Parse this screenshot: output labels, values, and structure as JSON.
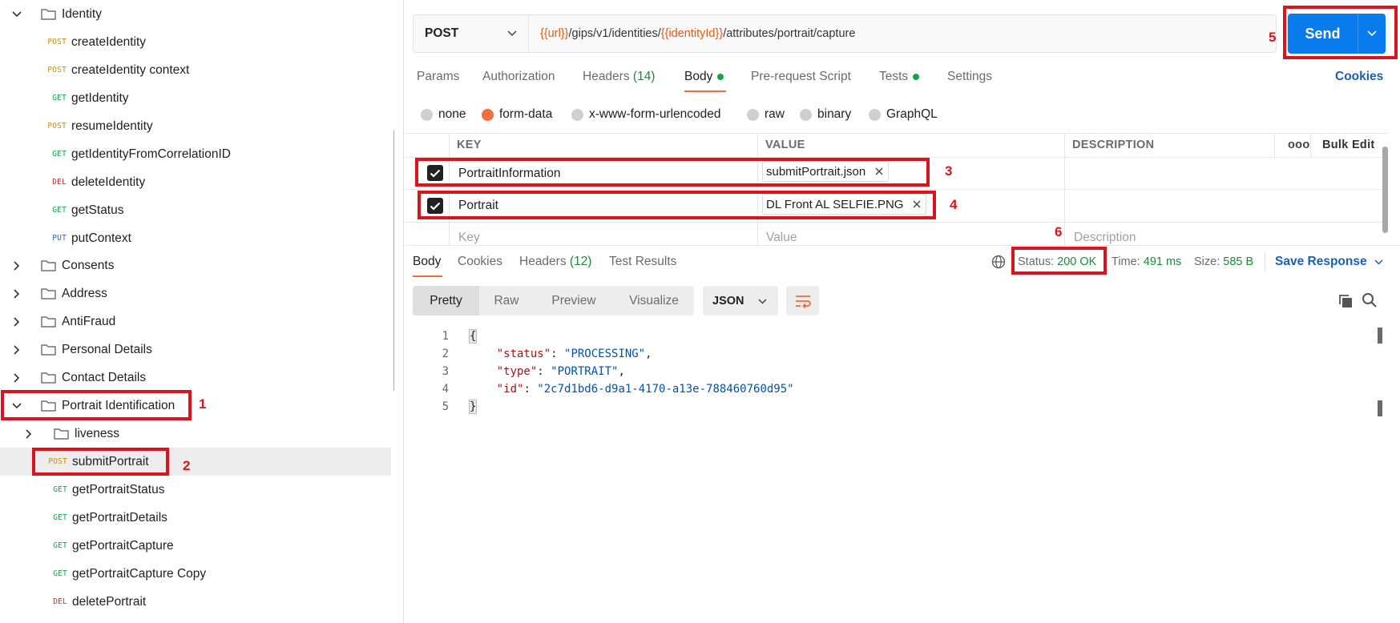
{
  "sidebar": {
    "folders_top": [
      {
        "label": "Identity"
      }
    ],
    "identity_requests": [
      {
        "method": "POST",
        "label": "createIdentity"
      },
      {
        "method": "POST",
        "label": "createIdentity context"
      },
      {
        "method": "GET",
        "label": "getIdentity"
      },
      {
        "method": "POST",
        "label": "resumeIdentity"
      },
      {
        "method": "GET",
        "label": "getIdentityFromCorrelationID"
      },
      {
        "method": "DEL",
        "label": "deleteIdentity"
      },
      {
        "method": "GET",
        "label": "getStatus"
      },
      {
        "method": "PUT",
        "label": "putContext"
      }
    ],
    "folders": [
      {
        "label": "Consents"
      },
      {
        "label": "Address"
      },
      {
        "label": "AntiFraud"
      },
      {
        "label": "Personal Details"
      },
      {
        "label": "Contact Details"
      },
      {
        "label": "Portrait Identification"
      },
      {
        "label": "liveness"
      }
    ],
    "portrait_requests": [
      {
        "method": "POST",
        "label": "submitPortrait"
      },
      {
        "method": "GET",
        "label": "getPortraitStatus"
      },
      {
        "method": "GET",
        "label": "getPortraitDetails"
      },
      {
        "method": "GET",
        "label": "getPortraitCapture"
      },
      {
        "method": "GET",
        "label": "getPortraitCapture Copy"
      },
      {
        "method": "DEL",
        "label": "deletePortrait"
      }
    ]
  },
  "request": {
    "method": "POST",
    "url_var1": "{{url}}",
    "url_part1": "/gips/v1/identities/",
    "url_var2": "{{identityId}}",
    "url_part2": "/attributes/portrait/capture",
    "send_label": "Send"
  },
  "tabs": {
    "params": "Params",
    "authorization": "Authorization",
    "headers": "Headers",
    "headers_count": "(14)",
    "body": "Body",
    "prerequest": "Pre-request Script",
    "tests": "Tests",
    "settings": "Settings",
    "cookies": "Cookies"
  },
  "body_types": {
    "none": "none",
    "form_data": "form-data",
    "urlencoded": "x-www-form-urlencoded",
    "raw": "raw",
    "binary": "binary",
    "graphql": "GraphQL"
  },
  "table": {
    "headers": {
      "key": "KEY",
      "value": "VALUE",
      "description": "DESCRIPTION",
      "more": "ooo",
      "bulk_edit": "Bulk Edit"
    },
    "rows": [
      {
        "key": "PortraitInformation",
        "value": "submitPortrait.json"
      },
      {
        "key": "Portrait",
        "value": "DL Front AL SELFIE.PNG"
      }
    ],
    "placeholders": {
      "key": "Key",
      "value": "Value",
      "description": "Description"
    }
  },
  "response": {
    "tabs": {
      "body": "Body",
      "cookies": "Cookies",
      "headers": "Headers",
      "headers_count": "(12)",
      "test_results": "Test Results"
    },
    "status_label": "Status:",
    "status_value": "200 OK",
    "time_label": "Time:",
    "time_value": "491 ms",
    "size_label": "Size:",
    "size_value": "585 B",
    "save_label": "Save Response",
    "views": {
      "pretty": "Pretty",
      "raw": "Raw",
      "preview": "Preview",
      "visualize": "Visualize"
    },
    "format": "JSON",
    "line_numbers": [
      "1",
      "2",
      "3",
      "4",
      "5"
    ],
    "json": {
      "open": "{",
      "close": "}",
      "k_status": "\"status\"",
      "v_status": "\"PROCESSING\"",
      "k_type": "\"type\"",
      "v_type": "\"PORTRAIT\"",
      "k_id": "\"id\"",
      "v_id": "\"2c7d1bd6-d9a1-4170-a13e-788460760d95\""
    }
  },
  "annotations": [
    "1",
    "2",
    "3",
    "4",
    "5",
    "6"
  ],
  "colors": {
    "accent_orange": "#f26b3a",
    "send_blue": "#097bed",
    "annotation_red": "#d9141c",
    "status_green": "#1a8a3c"
  }
}
